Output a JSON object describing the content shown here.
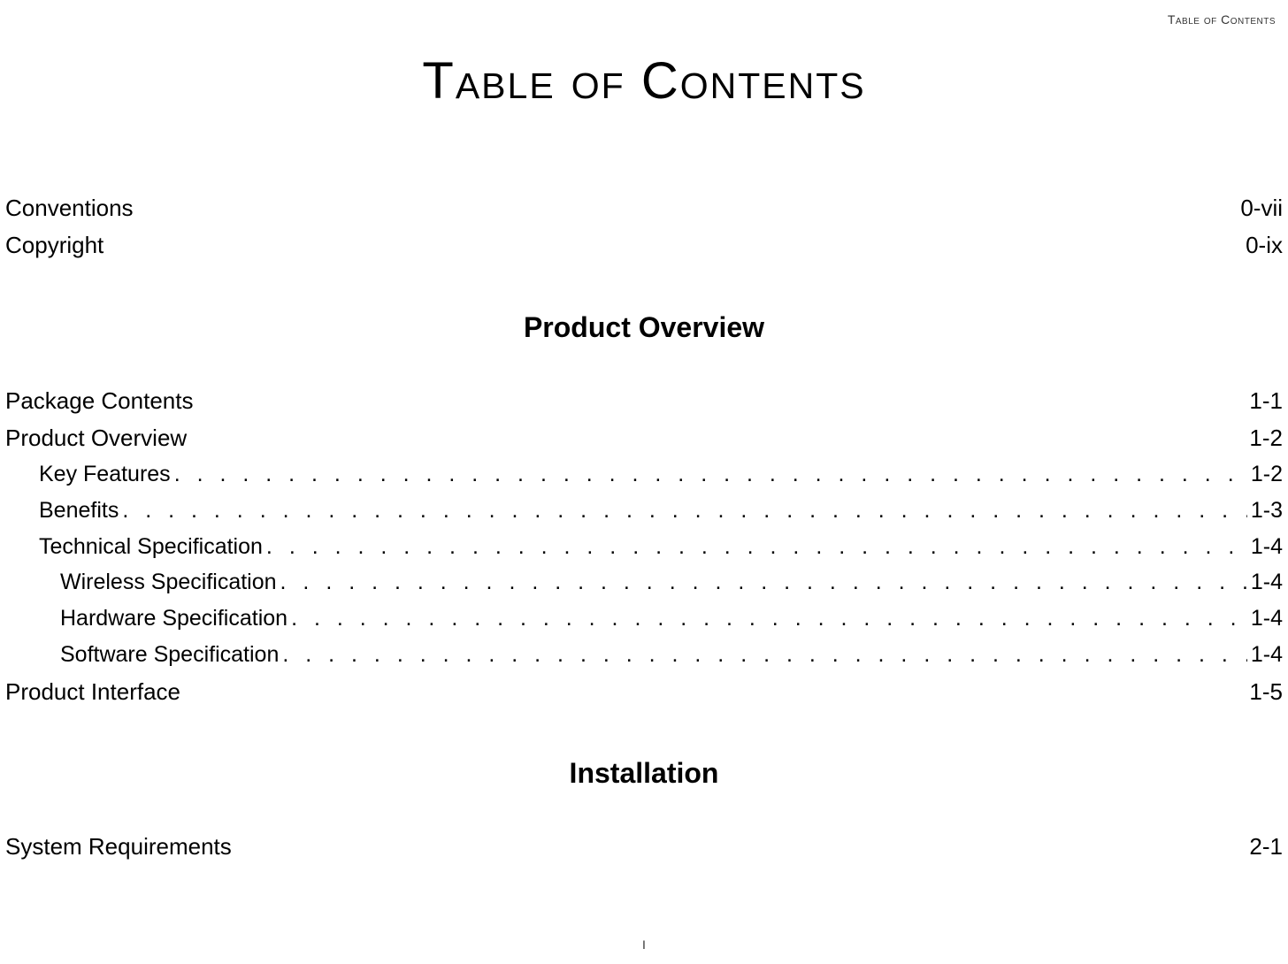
{
  "header": {
    "running_head": "Table of Contents"
  },
  "title": "Table of Contents",
  "front_matter": [
    {
      "label": "Conventions",
      "page": "0-vii"
    },
    {
      "label": "Copyright",
      "page": "0-ix"
    }
  ],
  "sections": [
    {
      "heading": "Product Overview",
      "entries": [
        {
          "label": "Package Contents",
          "page": "1-1",
          "indent": 0,
          "dotted": false
        },
        {
          "label": "Product Overview",
          "page": "1-2",
          "indent": 0,
          "dotted": false
        },
        {
          "label": "Key Features",
          "page": "1-2",
          "indent": 1,
          "dotted": true
        },
        {
          "label": "Benefits",
          "page": "1-3",
          "indent": 1,
          "dotted": true
        },
        {
          "label": "Technical Specification",
          "page": "1-4",
          "indent": 1,
          "dotted": true
        },
        {
          "label": "Wireless Specification",
          "page": "1-4",
          "indent": 2,
          "dotted": true
        },
        {
          "label": "Hardware Specification",
          "page": "1-4",
          "indent": 2,
          "dotted": true
        },
        {
          "label": "Software Specification",
          "page": "1-4",
          "indent": 2,
          "dotted": true
        },
        {
          "label": "Product Interface",
          "page": "1-5",
          "indent": 0,
          "dotted": false
        }
      ]
    },
    {
      "heading": "Installation",
      "entries": [
        {
          "label": "System Requirements",
          "page": "2-1",
          "indent": 0,
          "dotted": false
        }
      ]
    }
  ],
  "footer": {
    "page_number": "I"
  }
}
